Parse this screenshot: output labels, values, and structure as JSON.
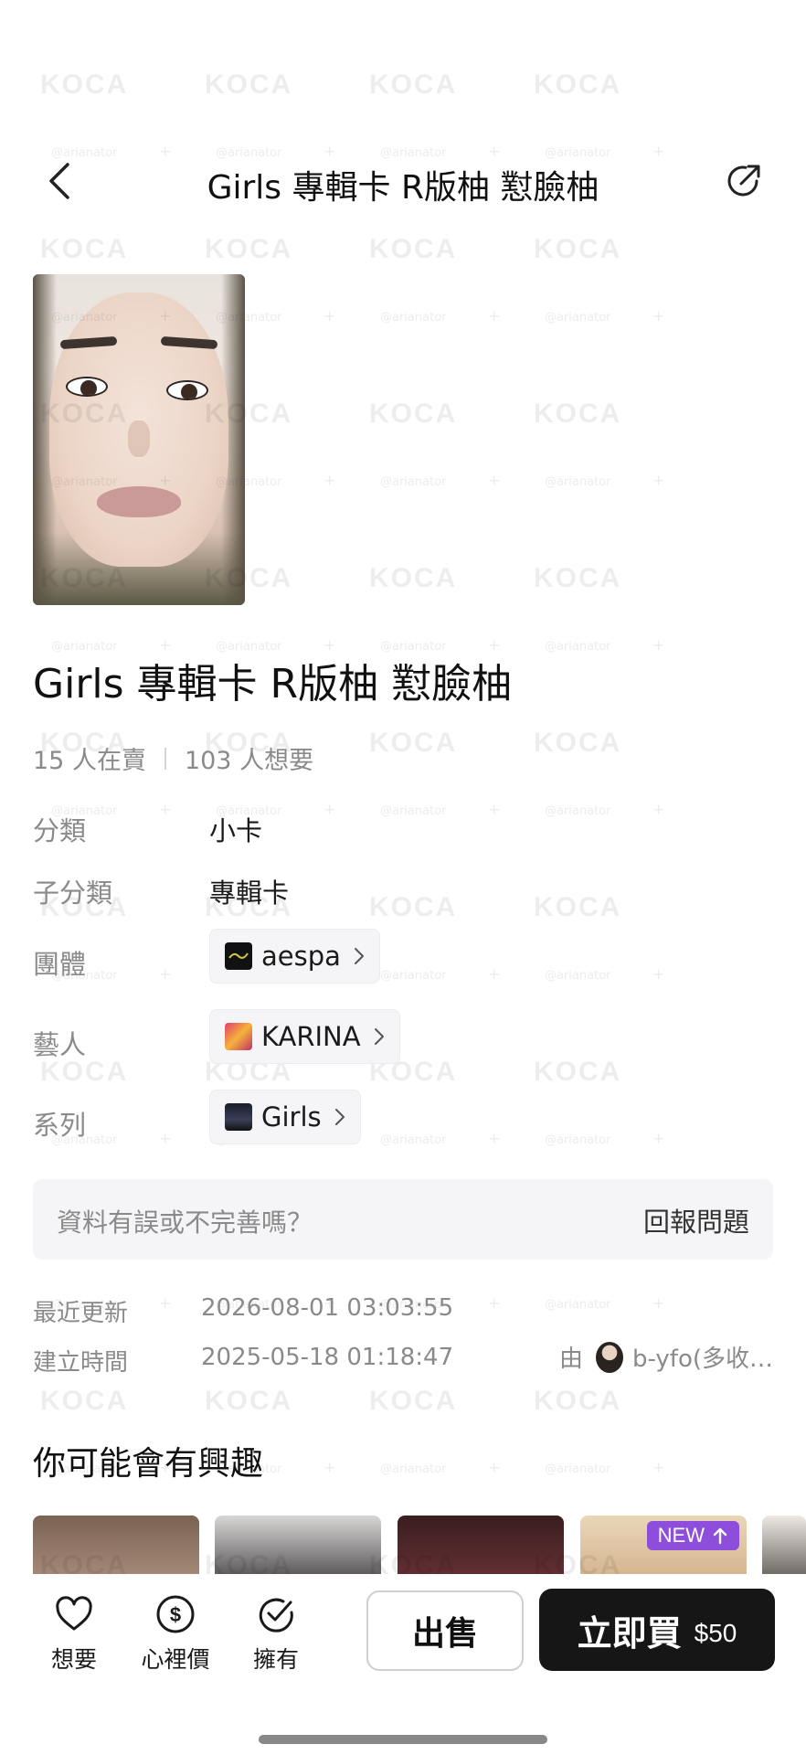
{
  "header": {
    "title": "Girls 專輯卡 R版柚 懟臉柚"
  },
  "product": {
    "title": "Girls 專輯卡 R版柚 懟臉柚",
    "selling_count": "15 人在賣",
    "wanting_count": "103 人想要"
  },
  "info": {
    "category_label": "分類",
    "category_value": "小卡",
    "subcategory_label": "子分類",
    "subcategory_value": "專輯卡",
    "group_label": "團體",
    "group_value": "aespa",
    "artist_label": "藝人",
    "artist_value": "KARINA",
    "series_label": "系列",
    "series_value": "Girls"
  },
  "report": {
    "prompt": "資料有誤或不完善嗎？",
    "link": "回報問題"
  },
  "meta": {
    "updated_label": "最近更新",
    "updated_value": "2026-08-01 03:03:55",
    "created_label": "建立時間",
    "created_value": "2025-05-18 01:18:47",
    "by_label": "由",
    "creator_name": "b-yfo(多收…"
  },
  "recommendations": {
    "title": "你可能會有興趣",
    "new_badge": "NEW"
  },
  "bottom_bar": {
    "want_label": "想要",
    "price_label": "心裡價",
    "own_label": "擁有",
    "sell_label": "出售",
    "buy_label": "立即買",
    "buy_price": "$50"
  },
  "watermark": {
    "brand": "KOCA",
    "handle": "@arianator"
  },
  "icons": {
    "back": "chevron-left-icon",
    "share": "share-icon",
    "want": "heart-icon",
    "price": "dollar-circle-icon",
    "own": "check-circle-icon",
    "chip_arrow": "chevron-right-icon",
    "new_arrow": "arrow-up-icon"
  },
  "colors": {
    "accent_badge": "#8e4ddb",
    "buy_button": "#161616",
    "muted_text": "#8a8a8a"
  }
}
